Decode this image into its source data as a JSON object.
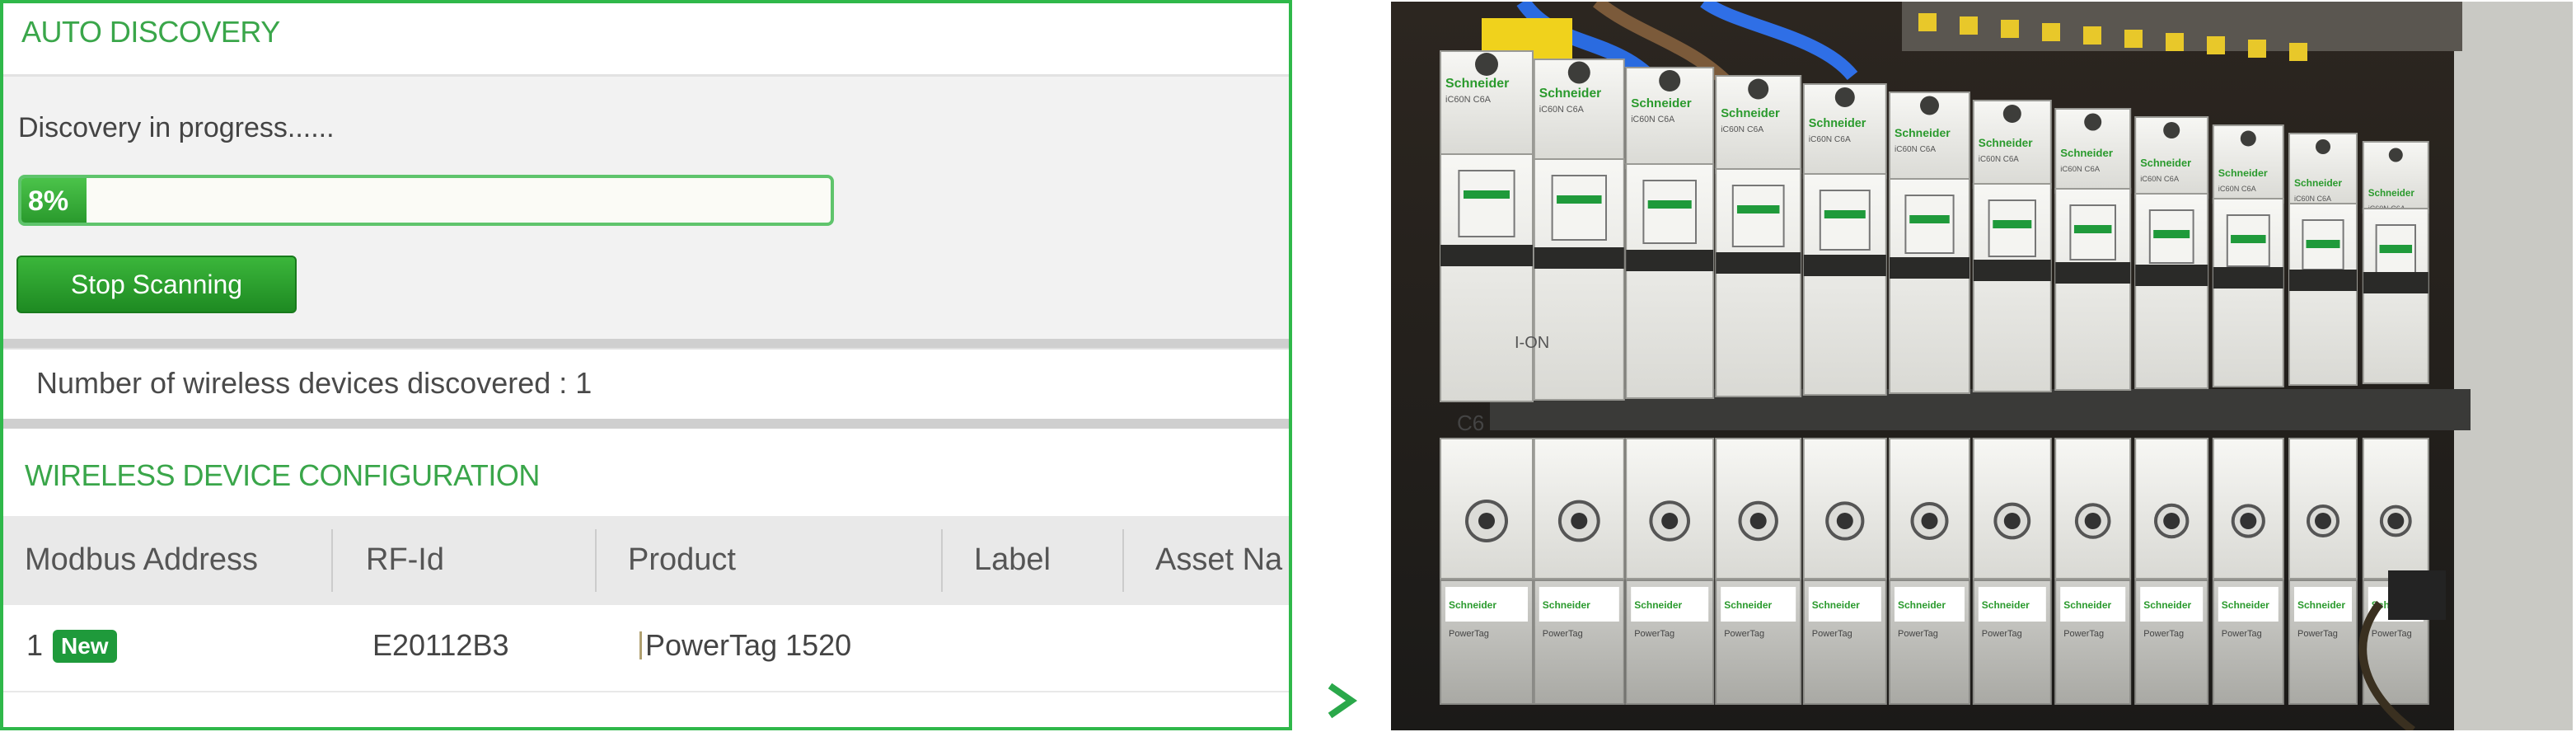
{
  "auto_discovery": {
    "title": "AUTO DISCOVERY",
    "status_text": "Discovery in progress......",
    "progress_percent": 8,
    "progress_label": "8%",
    "stop_button_label": "Stop Scanning",
    "devices_count_text": "Number of wireless devices discovered : 1"
  },
  "wireless_config": {
    "title": "WIRELESS DEVICE CONFIGURATION",
    "columns": [
      "Modbus Address",
      "RF-Id",
      "Product",
      "Label",
      "Asset Na"
    ],
    "rows": [
      {
        "modbus_address": "1",
        "badge": "New",
        "rf_id": "E20112B3",
        "product": "PowerTag 1520",
        "label": "",
        "asset_name": ""
      }
    ]
  },
  "arrow_glyph": ">",
  "photo": {
    "brand": "Schneider Electric",
    "breaker_model": "iC60N C6A",
    "rating": "C6",
    "switch_text": "I-ON",
    "tag_brand": "Schneider",
    "tag_product": "PowerTag"
  },
  "colors": {
    "accent_green": "#3aa64a",
    "button_green": "#2a9a2d",
    "badge_green": "#1f9a3b",
    "panel_border": "#2fb84a"
  }
}
